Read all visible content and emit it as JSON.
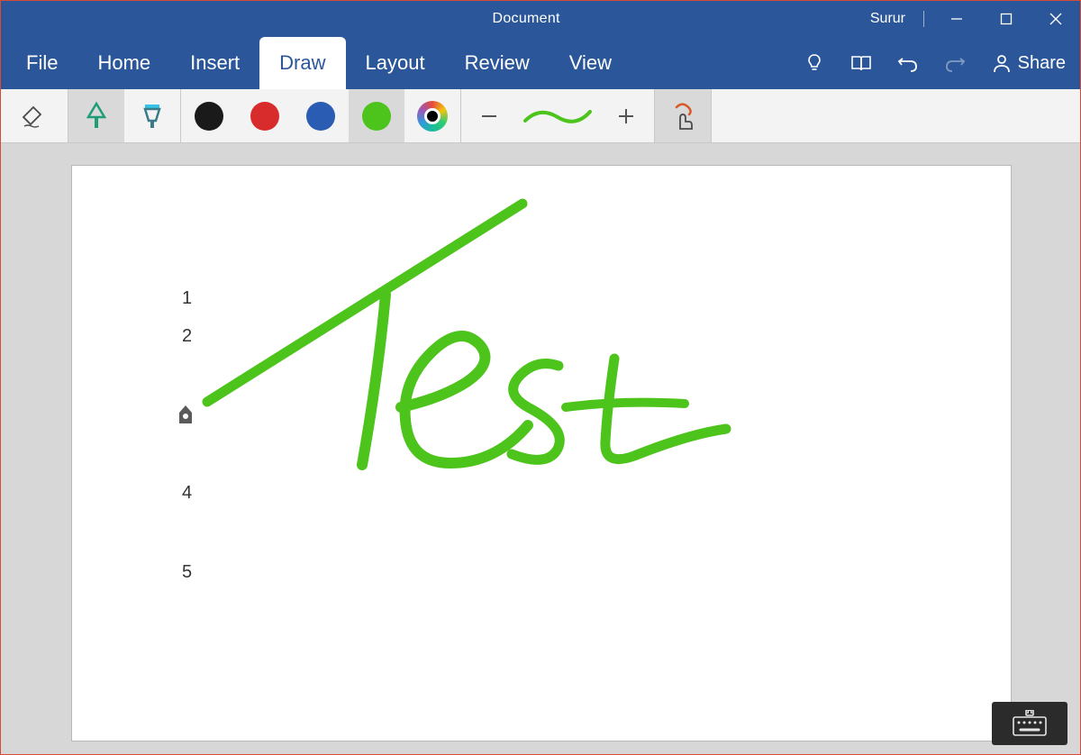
{
  "title": "Document",
  "user": "Surur",
  "tabs": [
    {
      "label": "File",
      "active": false
    },
    {
      "label": "Home",
      "active": false
    },
    {
      "label": "Insert",
      "active": false
    },
    {
      "label": "Draw",
      "active": true
    },
    {
      "label": "Layout",
      "active": false
    },
    {
      "label": "Review",
      "active": false
    },
    {
      "label": "View",
      "active": false
    }
  ],
  "share_label": "Share",
  "toolbar": {
    "eraser": "eraser",
    "pen_selected": true,
    "highlighter_selected": false,
    "colors": [
      {
        "name": "black",
        "hex": "#1a1a1a",
        "selected": false
      },
      {
        "name": "red",
        "hex": "#d82c2c",
        "selected": false
      },
      {
        "name": "blue",
        "hex": "#2b5cb3",
        "selected": false
      },
      {
        "name": "green",
        "hex": "#4cc41b",
        "selected": true
      }
    ],
    "stroke_preview_color": "#4cc41b"
  },
  "document": {
    "line_numbers": [
      "1",
      "2",
      "4",
      "5"
    ],
    "handwriting_text": "Test",
    "ink_color": "#4cc41b"
  }
}
